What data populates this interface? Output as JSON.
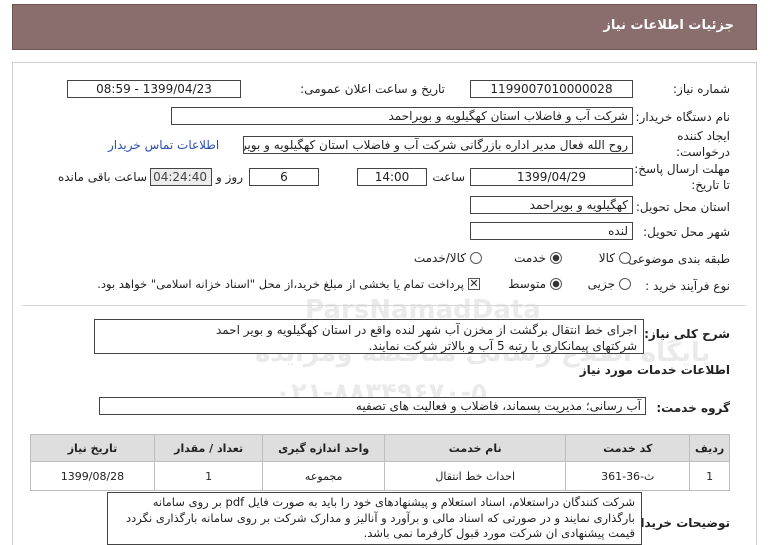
{
  "header": {
    "title": "جزئیات اطلاعات نیاز"
  },
  "form": {
    "need_number_label": "شماره نیاز:",
    "need_number": "1199007010000028",
    "announce_label": "تاریخ و ساعت اعلان عمومی:",
    "announce_value": "1399/04/23 - 08:59",
    "buyer_org_label": "نام دستگاه خریدار:",
    "buyer_org": "شرکت آب و فاضلاب استان کهگیلویه و بویراحمد",
    "creator_label_1": "ایجاد کننده",
    "creator_label_2": "درخواست:",
    "creator": "روح الله فعال مدیر اداره بازرگانی شرکت آب و فاضلاب استان کهگیلویه و بویراحمد",
    "contact_link": "اطلاعات تماس خریدار",
    "deadline_label_1": "مهلت ارسال پاسخ:",
    "deadline_label_2": "تا تاریخ:",
    "deadline_date": "1399/04/29",
    "time_label": "ساعت",
    "deadline_time": "14:00",
    "days_value": "6",
    "days_label": "روز و",
    "remaining_time": "04:24:40",
    "remaining_label": "ساعت باقی مانده",
    "province_label": "استان محل تحویل:",
    "province": "کهگیلویه و بویراحمد",
    "city_label": "شهر محل تحویل:",
    "city": "لنده",
    "category_label": "طبقه بندی موضوعی:",
    "category_options": [
      "کالا",
      "خدمت",
      "کالا/خدمت"
    ],
    "category_selected": "خدمت",
    "process_label": "نوع فرآیند خرید :",
    "process_options": [
      "جزیی",
      "متوسط"
    ],
    "process_selected": "متوسط",
    "payment_note": "پرداخت تمام یا بخشی از مبلغ خرید،از محل \"اسناد خزانه اسلامی\" خواهد بود.",
    "summary_label": "شرح کلی نیاز:",
    "summary_line1": "اجرای خط انتقال برگشت از مخزن آب شهر لنده واقع در استان کهگیلویه و بویر احمد",
    "summary_line2": "شرکتهای پیمانکاری با رتبه 5 آب و بالاتر شرکت نمایند.",
    "services_title": "اطلاعات خدمات مورد نیاز",
    "service_group_label": "گروه خدمت:",
    "service_group": "آب رسانی؛ مدیریت پسماند، فاضلاب و فعالیت های تصفیه",
    "buyer_notes_label": "توضیحات خریدار:",
    "buyer_notes": "شرکت کنندگان دراستعلام، اسناد استعلام و پیشنهادهای خود را باید به صورت فایل pdf بر روی سامانه بارگذاری نمایند و در صورتی که اسناد مالی و برآورد و آنالیز و مدارک شرکت بر روی سامانه بارگذاری نگردد قیمت پیشنهادی ان شرکت مورد قبول کارفرما نمی باشد."
  },
  "table": {
    "headers": [
      "ردیف",
      "کد خدمت",
      "نام خدمت",
      "واحد اندازه گیری",
      "تعداد / مقدار",
      "تاریخ نیاز"
    ],
    "rows": [
      [
        "1",
        "ث-36-361",
        "احداث خط انتقال",
        "مجموعه",
        "1",
        "1399/08/28"
      ]
    ]
  },
  "watermark": {
    "line1": "ParsNamadData",
    "line2": "پایگاه اطلاع رسانی مناقصه ومزایده",
    "line3": "۰۲۱-۸۸۳۴۹۶۷۰-۵"
  },
  "colors": {
    "header_bg": "#8a6d6d",
    "link": "#2a4fb0",
    "table_header_bg": "#dedede"
  }
}
